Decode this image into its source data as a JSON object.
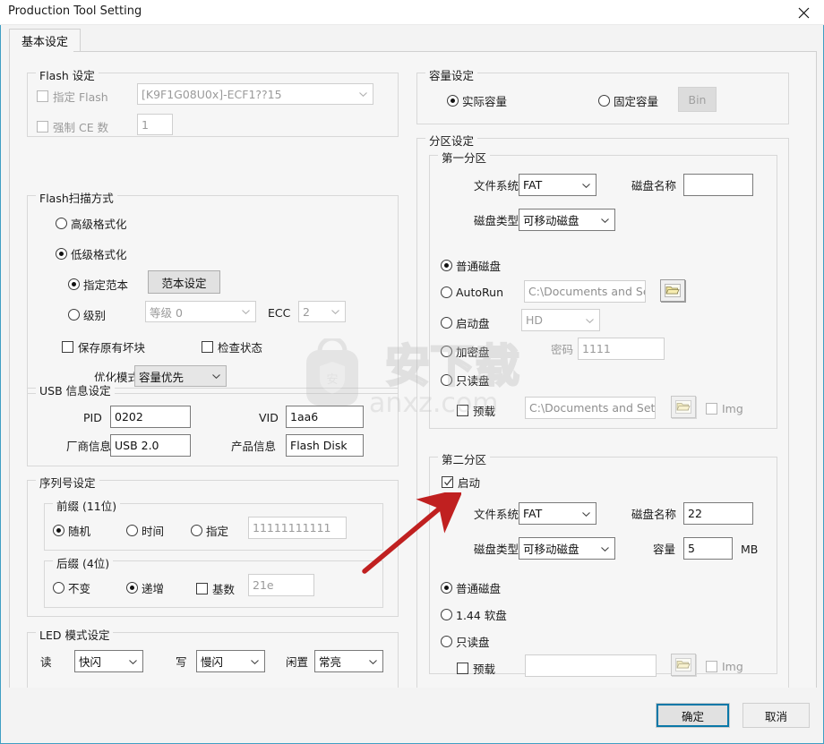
{
  "window": {
    "title": "Production Tool Setting",
    "close_icon": "close-icon"
  },
  "tabs": [
    {
      "label": "基本设定",
      "selected": true
    }
  ],
  "flash_settings": {
    "legend": "Flash 设定",
    "specify_flash": {
      "label": "指定 Flash",
      "checked": false,
      "enabled": false
    },
    "flash_model": {
      "value": "[K9F1G08U0x]-ECF1??15",
      "enabled": false
    },
    "force_ce": {
      "label": "强制 CE 数",
      "checked": false,
      "enabled": false
    },
    "ce_count": {
      "value": "1",
      "enabled": false
    }
  },
  "flash_scan": {
    "legend": "Flash扫描方式",
    "high_format": {
      "label": "高级格式化",
      "selected": false
    },
    "low_format": {
      "label": "低级格式化",
      "selected": true
    },
    "specify_sample": {
      "label": "指定范本",
      "selected": true
    },
    "sample_button": {
      "label": "范本设定"
    },
    "level": {
      "label": "级别",
      "selected": false
    },
    "level_value": {
      "value": "等级 0",
      "enabled": false
    },
    "ecc_label": "ECC",
    "ecc_value": {
      "value": "2",
      "enabled": false
    },
    "keep_bad_block": {
      "label": "保存原有坏块",
      "checked": false
    },
    "check_status": {
      "label": "检查状态",
      "checked": false
    },
    "optimize_label": "优化模式",
    "optimize_value": {
      "value": "容量优先"
    }
  },
  "usb_info": {
    "legend": "USB 信息设定",
    "pid_label": "PID",
    "pid_value": "0202",
    "vid_label": "VID",
    "vid_value": "1aa6",
    "vendor_label": "厂商信息",
    "vendor_value": "USB 2.0",
    "product_label": "产品信息",
    "product_value": "Flash Disk"
  },
  "serial": {
    "legend": "序列号设定",
    "prefix": {
      "legend": "前缀 (11位)",
      "random": {
        "label": "随机",
        "selected": true
      },
      "time": {
        "label": "时间",
        "selected": false
      },
      "specify": {
        "label": "指定",
        "selected": false
      },
      "value": {
        "value": "11111111111",
        "enabled": false
      }
    },
    "suffix": {
      "legend": "后缀 (4位)",
      "fixed": {
        "label": "不变",
        "selected": false
      },
      "increment": {
        "label": "递增",
        "selected": true
      },
      "base": {
        "label": "基数",
        "checked": false
      },
      "value": {
        "value": "21e",
        "enabled": false
      }
    }
  },
  "led": {
    "legend": "LED 模式设定",
    "read_label": "读",
    "read_value": "快闪",
    "write_label": "写",
    "write_value": "慢闪",
    "idle_label": "闲置",
    "idle_value": "常亮"
  },
  "capacity": {
    "legend": "容量设定",
    "actual": {
      "label": "实际容量",
      "selected": true
    },
    "fixed": {
      "label": "固定容量",
      "selected": false
    },
    "bin_button": {
      "label": "Bin",
      "enabled": false
    }
  },
  "partition": {
    "legend": "分区设定",
    "first": {
      "legend": "第一分区",
      "fs_label": "文件系统",
      "fs_value": "FAT",
      "volume_label": "磁盘名称",
      "volume_value": "",
      "disk_type_label": "磁盘类型",
      "disk_type_value": "可移动磁盘",
      "normal_disk": {
        "label": "普通磁盘",
        "selected": true
      },
      "autorun": {
        "label": "AutoRun",
        "selected": false
      },
      "autorun_path": {
        "value": "C:\\Documents and Set",
        "enabled": false
      },
      "autorun_browse": {
        "icon": "folder-icon",
        "enabled": true
      },
      "boot_disk": {
        "label": "启动盘",
        "selected": false
      },
      "boot_value": {
        "value": "HD",
        "enabled": false
      },
      "encrypt_disk": {
        "label": "加密盘",
        "selected": false
      },
      "password_label": "密码",
      "password_value": {
        "value": "1111",
        "enabled": false
      },
      "readonly_disk": {
        "label": "只读盘",
        "selected": false
      },
      "preload": {
        "label": "预载",
        "checked": false
      },
      "preload_path": {
        "value": "C:\\Documents and Settin",
        "enabled": false
      },
      "preload_browse": {
        "icon": "folder-icon",
        "enabled": false
      },
      "img": {
        "label": "Img",
        "checked": false,
        "enabled": false
      }
    },
    "second": {
      "legend": "第二分区",
      "enable": {
        "label": "启动",
        "checked": true
      },
      "fs_label": "文件系统",
      "fs_value": "FAT",
      "volume_label": "磁盘名称",
      "volume_value": "22",
      "disk_type_label": "磁盘类型",
      "disk_type_value": "可移动磁盘",
      "capacity_label": "容量",
      "capacity_value": "5",
      "capacity_unit": "MB",
      "normal_disk": {
        "label": "普通磁盘",
        "selected": true
      },
      "floppy": {
        "label": "1.44 软盘",
        "selected": false
      },
      "readonly_disk": {
        "label": "只读盘",
        "selected": false
      },
      "preload": {
        "label": "预载",
        "checked": false
      },
      "preload_path": {
        "value": "",
        "enabled": true
      },
      "preload_browse": {
        "icon": "folder-icon",
        "enabled": false
      },
      "img": {
        "label": "Img",
        "checked": false,
        "enabled": false
      }
    }
  },
  "footer": {
    "ok_label": "确定",
    "cancel_label": "取消"
  },
  "watermark": {
    "text_cn": "安下载",
    "text_en": "anxz.com",
    "badge": "安"
  },
  "colors": {
    "window_border": "#3f9fc4",
    "panel_bg": "#f6f6f6",
    "group_border": "#d8d8d8",
    "focus_outline": "#0a78a8",
    "annotation_arrow": "#cc2222"
  }
}
